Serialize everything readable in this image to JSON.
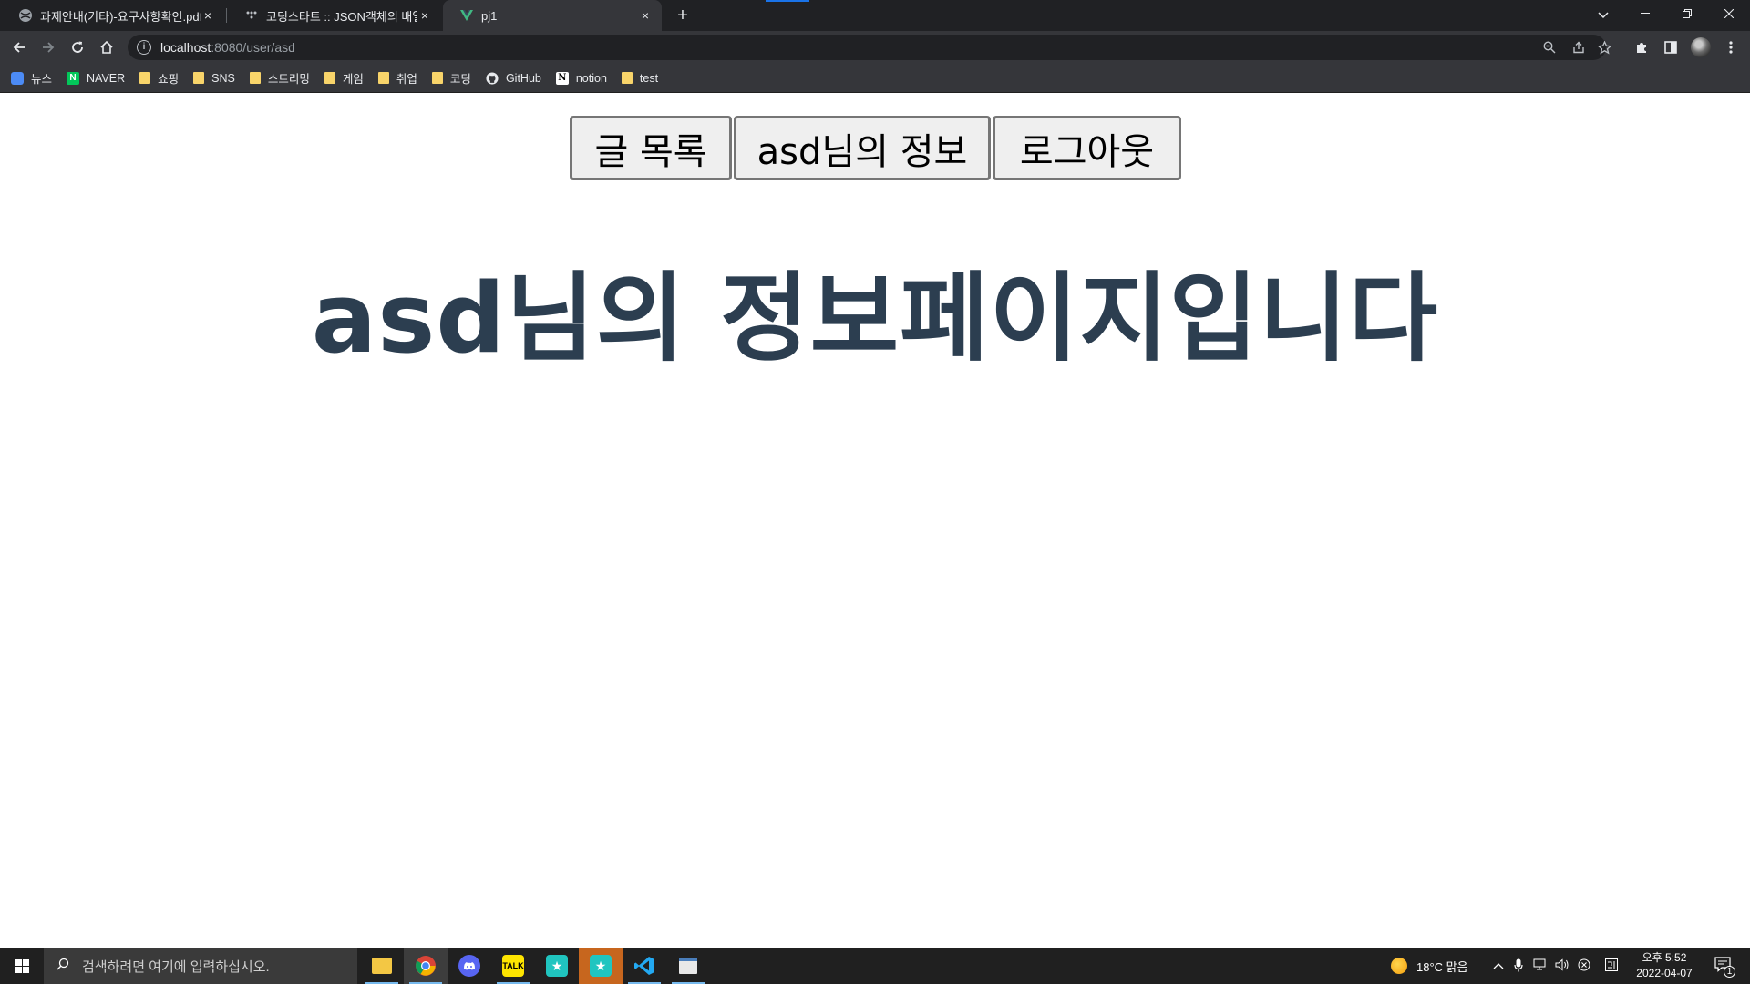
{
  "browser": {
    "tabs": [
      {
        "title": "과제안내(기타)-요구사항확인.pdf",
        "close": "×",
        "favicon": "globe-icon"
      },
      {
        "title": "코딩스타트 :: JSON객체의 배열로",
        "close": "×",
        "favicon": "dots-icon"
      },
      {
        "title": "pj1",
        "close": "×",
        "favicon": "vue-icon"
      }
    ],
    "new_tab": "+",
    "url_host": "localhost",
    "url_path": ":8080/user/asd",
    "bookmarks": [
      {
        "label": "뉴스",
        "icon": "news-icon"
      },
      {
        "label": "NAVER",
        "icon": "naver-icon"
      },
      {
        "label": "쇼핑",
        "icon": "folder-icon"
      },
      {
        "label": "SNS",
        "icon": "folder-icon"
      },
      {
        "label": "스트리밍",
        "icon": "folder-icon"
      },
      {
        "label": "게임",
        "icon": "folder-icon"
      },
      {
        "label": "취업",
        "icon": "folder-icon"
      },
      {
        "label": "코딩",
        "icon": "folder-icon"
      },
      {
        "label": "GitHub",
        "icon": "github-icon"
      },
      {
        "label": "notion",
        "icon": "notion-icon"
      },
      {
        "label": "test",
        "icon": "folder-icon"
      }
    ]
  },
  "page": {
    "nav": {
      "posts": "글 목록",
      "profile": "asd님의 정보",
      "logout": "로그아웃"
    },
    "title": "asd님의 정보페이지입니다"
  },
  "taskbar": {
    "search_placeholder": "검색하려면 여기에 입력하십시오.",
    "weather": "18°C  맑음",
    "time": "오후 5:52",
    "date": "2022-04-07",
    "notification_count": "1",
    "kakao_label": "TALK"
  },
  "colors": {
    "title": "#2c3e50",
    "chrome_dark": "#202124",
    "chrome_toolbar": "#35363a"
  }
}
